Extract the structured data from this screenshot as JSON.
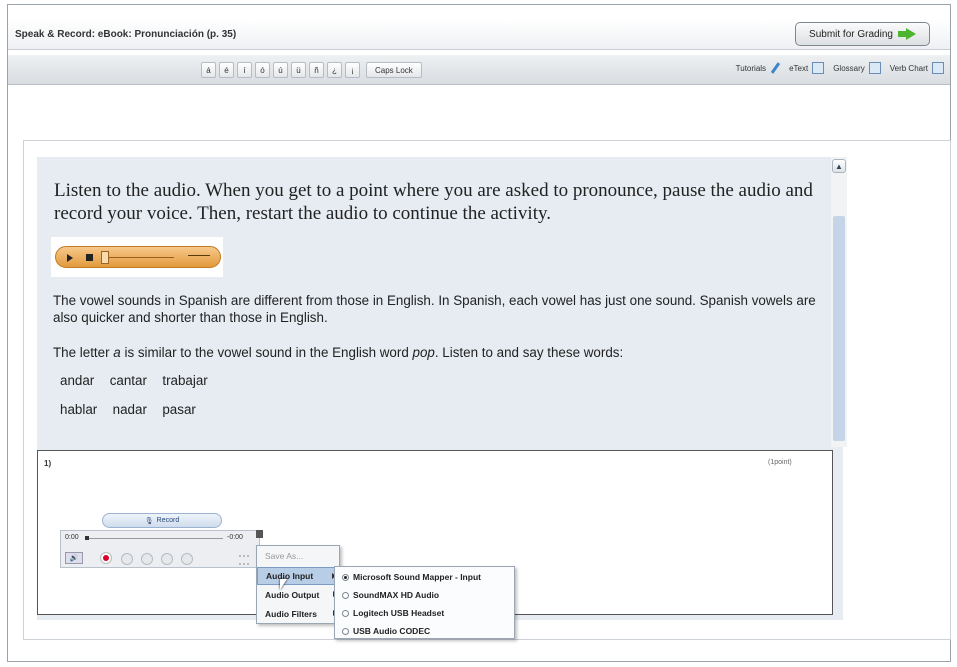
{
  "header": {
    "title": "Speak & Record: eBook: Pronunciación (p. 35)",
    "submit_label": "Submit for Grading"
  },
  "toolbar": {
    "chars": [
      "á",
      "é",
      "í",
      "ó",
      "ú",
      "ü",
      "ñ",
      "¿",
      "¡"
    ],
    "caps_lock": "Caps Lock",
    "tools": {
      "tutorials": "Tutorials",
      "etext": "eText",
      "glossary": "Glossary",
      "verb_chart": "Verb Chart"
    }
  },
  "activity": {
    "instructions": "Listen to the audio. When you get to a point where you are asked to pronounce, pause the audio and record your voice. Then, restart the audio to continue the activity.",
    "para1": "The vowel sounds in Spanish are different from those in English. In Spanish, each vowel has just one sound. Spanish vowels are also quicker and shorter than those in English.",
    "para2_a": "The letter ",
    "para2_letter": "a",
    "para2_b": " is similar to the vowel sound in the English word ",
    "para2_word": "pop",
    "para2_c": ". Listen to and say these words:",
    "words_row1": "andar  cantar  trabajar",
    "words_row2": "hablar  nadar  pasar"
  },
  "question": {
    "number": "1)",
    "points": "(1point)",
    "record_label": "Record",
    "time_start": "0:00",
    "time_end": "-0:00"
  },
  "context_menu": {
    "save_as": "Save As...",
    "audio_input": "Audio Input",
    "audio_output": "Audio Output",
    "audio_filters": "Audio Filters"
  },
  "audio_input_options": [
    {
      "label": "Microsoft Sound Mapper - Input",
      "selected": true
    },
    {
      "label": "SoundMAX HD Audio",
      "selected": false
    },
    {
      "label": "Logitech USB Headset",
      "selected": false
    },
    {
      "label": "USB Audio CODEC",
      "selected": false
    }
  ]
}
